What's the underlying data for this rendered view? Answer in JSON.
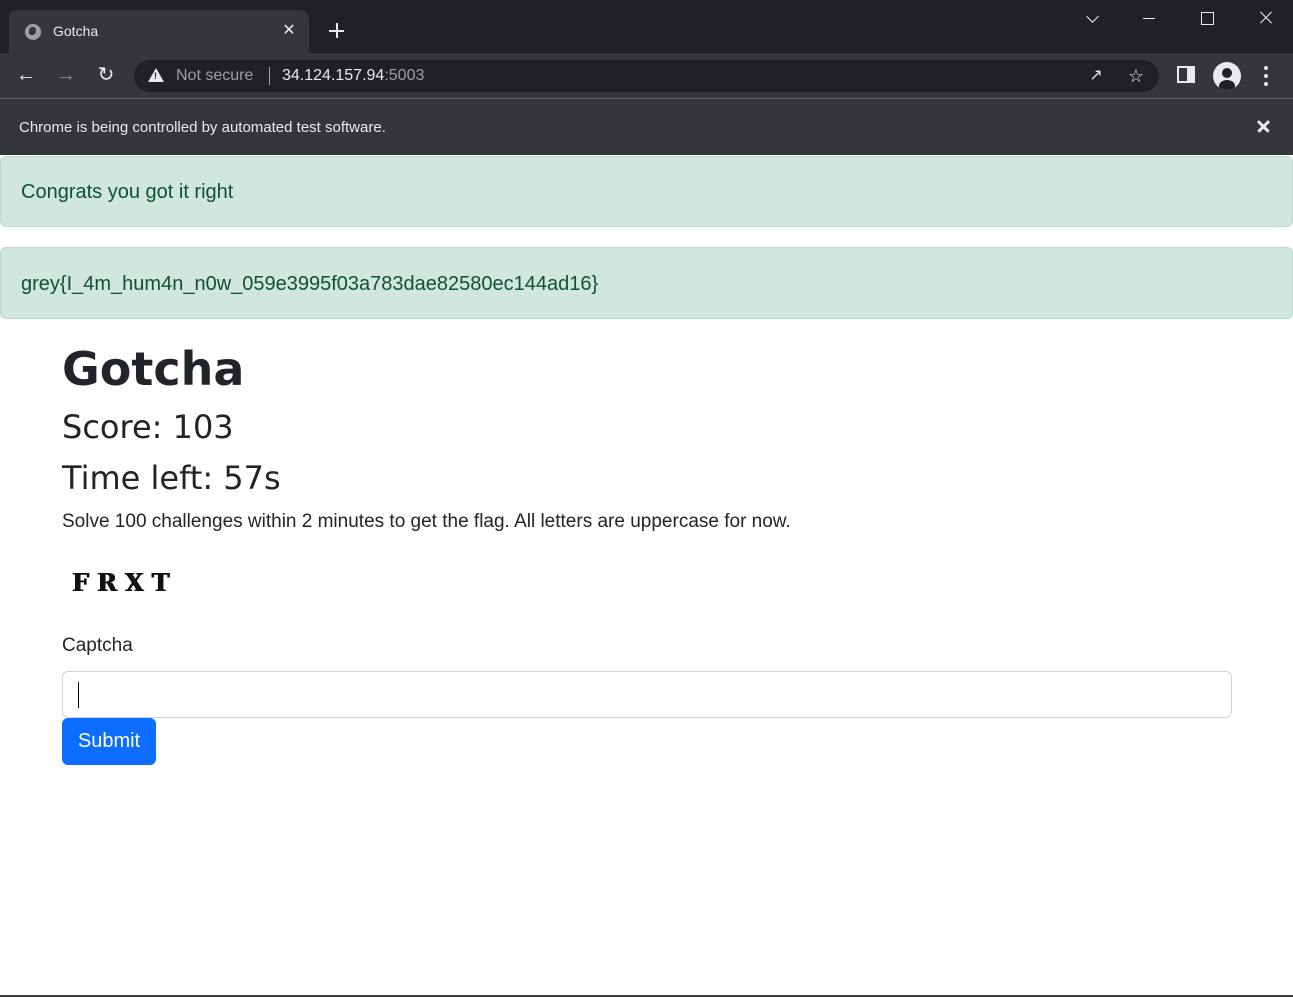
{
  "browser": {
    "tab_title": "Gotcha",
    "tab_close_glyph": "✕",
    "security_label": "Not secure",
    "url_host": "34.124.157.94",
    "url_port": ":5003",
    "automation_notice": "Chrome is being controlled by automated test software.",
    "icons": [
      "globe-icon",
      "close-icon",
      "plus-icon",
      "chevron-down-icon",
      "minimize-icon",
      "maximize-icon",
      "close-window-icon",
      "back-arrow-icon",
      "forward-arrow-icon",
      "reload-icon",
      "warning-icon",
      "share-icon",
      "star-icon",
      "side-panel-icon",
      "profile-icon",
      "kebab-menu-icon"
    ]
  },
  "alerts": [
    {
      "text": "Congrats you got it right"
    },
    {
      "text": "grey{I_4m_hum4n_n0w_059e3995f03a783dae82580ec144ad16}"
    }
  ],
  "page": {
    "title": "Gotcha",
    "score": "Score: 103",
    "time_left": "Time left: 57s",
    "instructions": "Solve 100 challenges within 2 minutes to get the flag. All letters are uppercase for now.",
    "captcha_image_text": "FRXT",
    "captcha_label": "Captcha",
    "captcha_value": "",
    "submit_label": "Submit"
  },
  "colors": {
    "alert_bg": "#d1e7dd",
    "alert_text": "#0f5132",
    "primary": "#0d6efd",
    "chrome_dark": "#202124",
    "chrome_toolbar": "#35363a"
  }
}
